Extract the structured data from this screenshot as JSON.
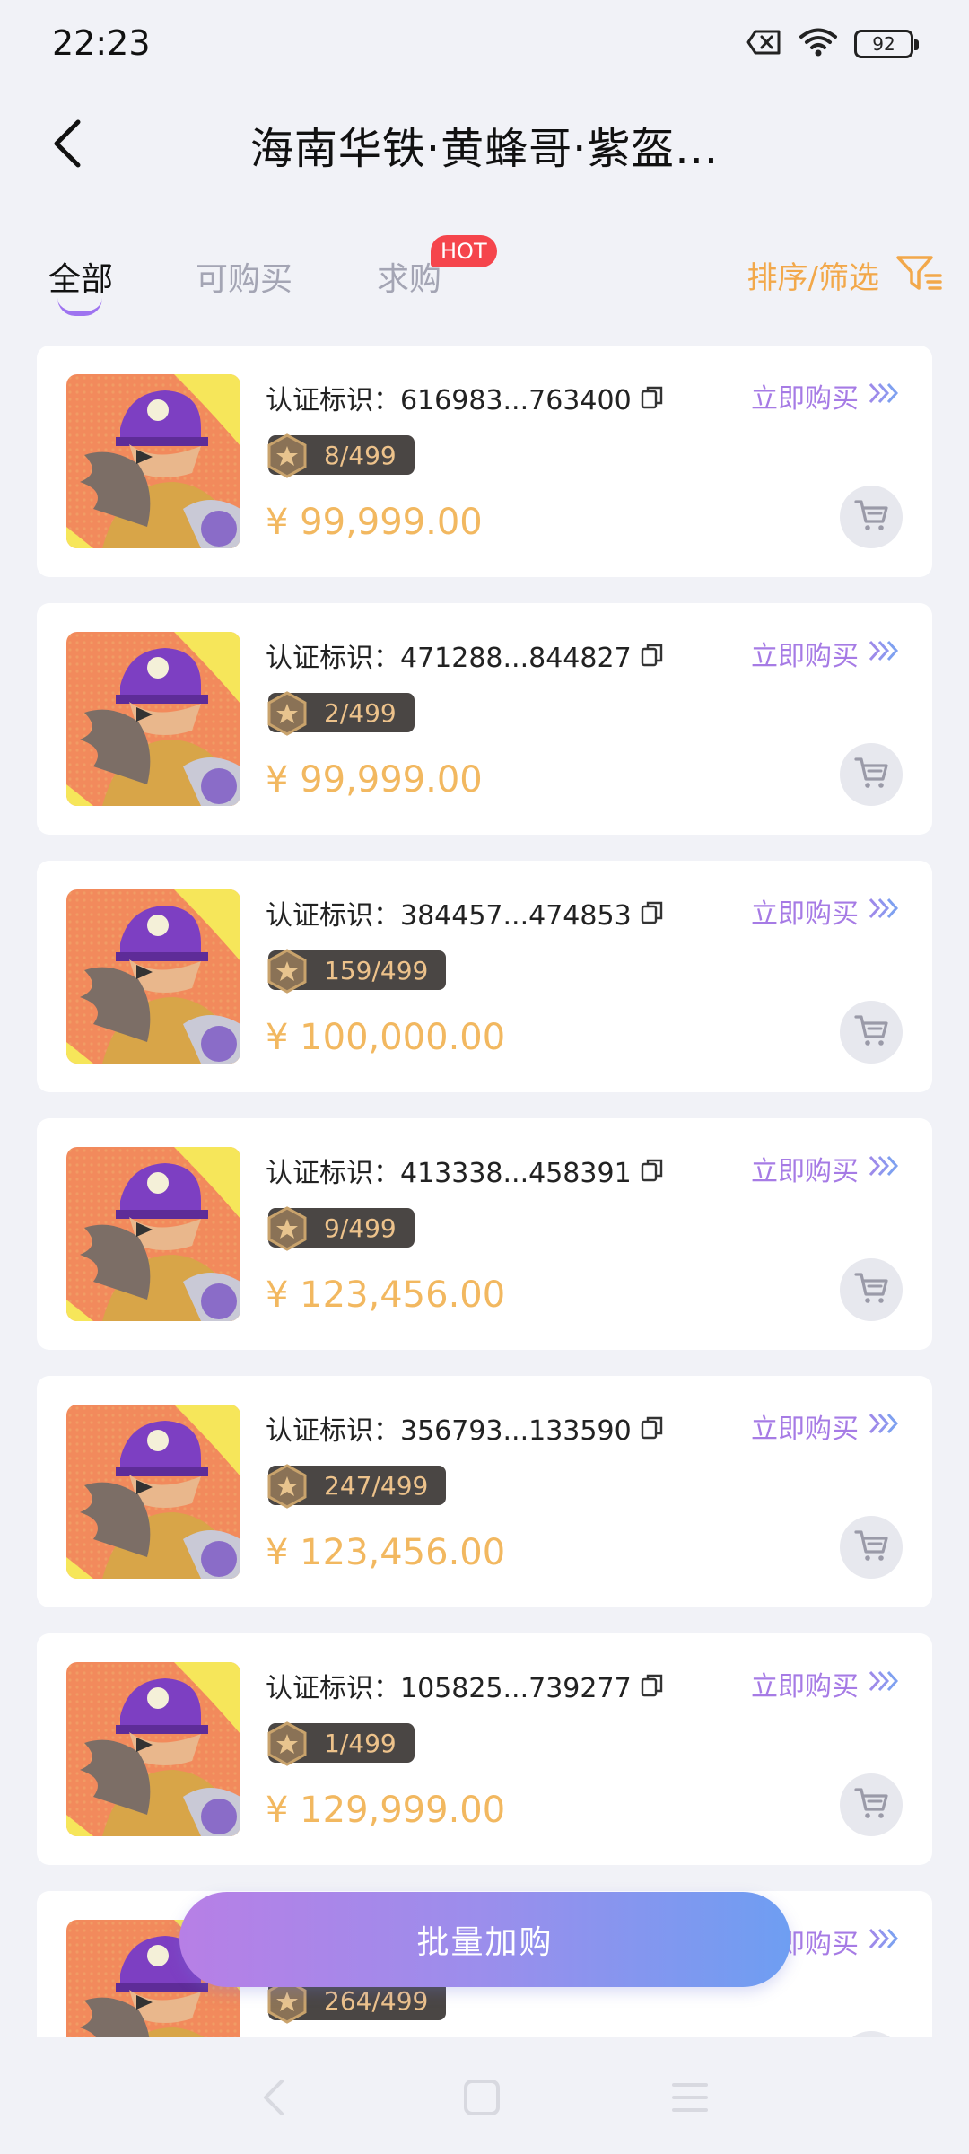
{
  "status_bar": {
    "time": "22:23",
    "battery": "92",
    "icons": [
      "sim-off-icon",
      "wifi-icon",
      "battery-icon"
    ]
  },
  "header": {
    "title": "海南华铁·黄蜂哥·紫盔..."
  },
  "tabs": [
    {
      "label": "全部",
      "active": true
    },
    {
      "label": "可购买",
      "active": false
    },
    {
      "label": "求购",
      "active": false
    }
  ],
  "hot_badge": "HOT",
  "sort_filter": {
    "label": "排序/筛选"
  },
  "listing_labels": {
    "cert_prefix": "认证标识：",
    "buy_now": "立即购买"
  },
  "listings": [
    {
      "cert_id": "616983...763400",
      "edition": "8/499",
      "price": "¥ 99,999.00"
    },
    {
      "cert_id": "471288...844827",
      "edition": "2/499",
      "price": "¥ 99,999.00"
    },
    {
      "cert_id": "384457...474853",
      "edition": "159/499",
      "price": "¥ 100,000.00"
    },
    {
      "cert_id": "413338...458391",
      "edition": "9/499",
      "price": "¥ 123,456.00"
    },
    {
      "cert_id": "356793...133590",
      "edition": "247/499",
      "price": "¥ 123,456.00"
    },
    {
      "cert_id": "105825...739277",
      "edition": "1/499",
      "price": "¥ 129,999.00"
    },
    {
      "cert_id": "",
      "edition": "264/499",
      "price": ""
    }
  ],
  "batch_button": "批量加购",
  "colors": {
    "accent_purple": "#A67BE5",
    "price_orange": "#F2B860",
    "hot_red": "#F5454C",
    "filter_orange": "#F2A84A"
  }
}
